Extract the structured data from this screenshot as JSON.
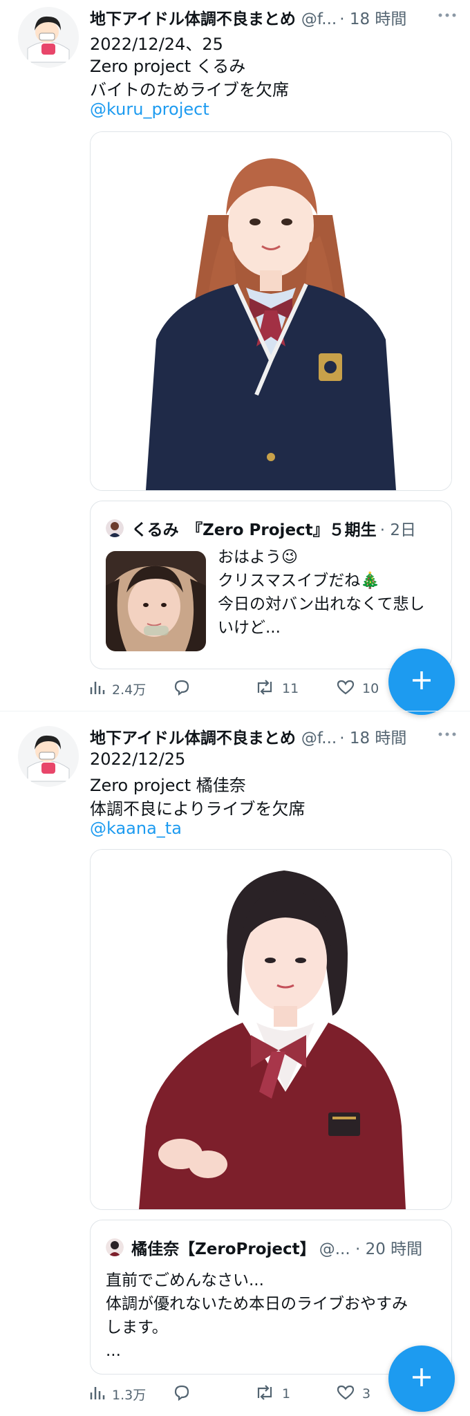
{
  "tweets": [
    {
      "author_name": "地下アイドル体調不良まとめ",
      "author_handle": "@f...",
      "time": "· 18 時間",
      "lines": [
        "2022/12/24、25",
        "Zero project くるみ",
        "バイトのためライブを欠席"
      ],
      "mention": "@kuru_project",
      "quote": {
        "name": "くるみ　『Zero Project』５期生",
        "meta": "· 2日",
        "text": [
          "おはよう😉",
          "クリスマスイブだね🎄",
          "今日の対バン出れなくて悲し",
          "いけど..."
        ]
      },
      "stats": {
        "views": "2.4万",
        "replies": "",
        "retweets": "11",
        "likes": "10"
      }
    },
    {
      "author_name": "地下アイドル体調不良まとめ",
      "author_handle": "@f...",
      "time": "· 18 時間",
      "lines": [
        "2022/12/25",
        "Zero project 橘佳奈",
        "体調不良によりライブを欠席"
      ],
      "mention": "@kaana_ta",
      "quote": {
        "name": "橘佳奈【ZeroProject】",
        "meta": "@... · 20 時間",
        "text": [
          "直前でごめんなさい...",
          "体調が優れないため本日のライブおやすみ",
          "します。",
          "..."
        ]
      },
      "stats": {
        "views": "1.3万",
        "replies": "",
        "retweets": "1",
        "likes": "3"
      }
    }
  ],
  "icons": {
    "more": "more-dots-icon",
    "views": "views-icon",
    "reply": "reply-icon",
    "retweet": "retweet-icon",
    "like": "like-icon",
    "compose": "compose-plus-icon"
  },
  "colors": {
    "link": "#1d9bf0",
    "meta": "#536471",
    "blazer_navy": "#1f2a48",
    "blazer_red": "#7d1f2b"
  }
}
